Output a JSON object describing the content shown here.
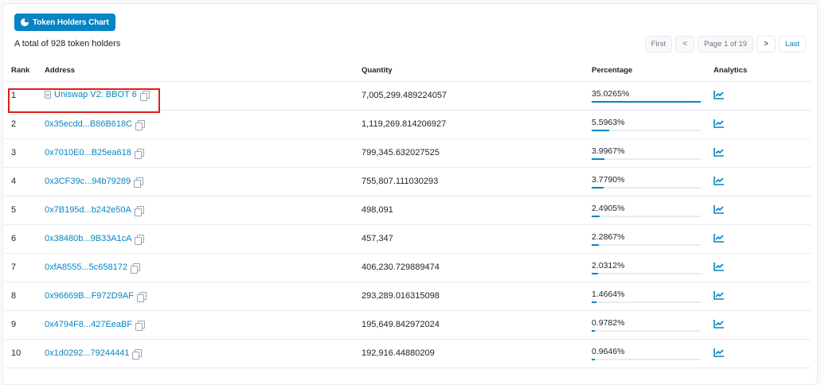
{
  "header": {
    "chart_button_label": "Token Holders Chart",
    "total_text": "A total of 928 token holders"
  },
  "pager": {
    "first": "First",
    "prev": "<",
    "page_info": "Page 1 of 19",
    "next": ">",
    "last": "Last"
  },
  "columns": {
    "rank": "Rank",
    "address": "Address",
    "quantity": "Quantity",
    "percentage": "Percentage",
    "analytics": "Analytics"
  },
  "rows": [
    {
      "rank": "1",
      "address": "Uniswap V2: BBOT 6",
      "contract": true,
      "quantity": "7,005,299.489224057",
      "percentage": "35.0265%",
      "pct": 35.0265
    },
    {
      "rank": "2",
      "address": "0x35ecdd...B86B618C",
      "quantity": "1,119,269.814206927",
      "percentage": "5.5963%",
      "pct": 5.5963
    },
    {
      "rank": "3",
      "address": "0x7010E0...B25ea618",
      "quantity": "799,345.632027525",
      "percentage": "3.9967%",
      "pct": 3.9967
    },
    {
      "rank": "4",
      "address": "0x3CF39c...94b79289",
      "quantity": "755,807.111030293",
      "percentage": "3.7790%",
      "pct": 3.779
    },
    {
      "rank": "5",
      "address": "0x7B195d...b242e50A",
      "quantity": "498,091",
      "percentage": "2.4905%",
      "pct": 2.4905
    },
    {
      "rank": "6",
      "address": "0x38480b...9B33A1cA",
      "quantity": "457,347",
      "percentage": "2.2867%",
      "pct": 2.2867
    },
    {
      "rank": "7",
      "address": "0xfA8555...5c658172",
      "quantity": "406,230.729889474",
      "percentage": "2.0312%",
      "pct": 2.0312
    },
    {
      "rank": "8",
      "address": "0x96669B...F972D9AF",
      "quantity": "293,289.016315098",
      "percentage": "1.4664%",
      "pct": 1.4664
    },
    {
      "rank": "9",
      "address": "0x4794F8...427EeaBF",
      "quantity": "195,649.842972024",
      "percentage": "0.9782%",
      "pct": 0.9782
    },
    {
      "rank": "10",
      "address": "0x1d0292...79244441",
      "quantity": "192,916.44880209",
      "percentage": "0.9646%",
      "pct": 0.9646
    }
  ],
  "colors": {
    "accent": "#0784c3",
    "highlight": "#e11d1d"
  }
}
